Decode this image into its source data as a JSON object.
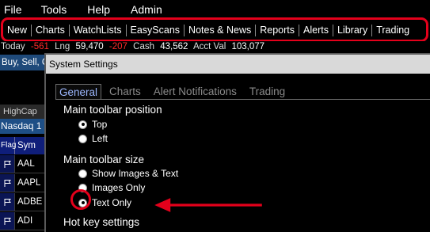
{
  "menubar": {
    "items": [
      "File",
      "Tools",
      "Help",
      "Admin"
    ]
  },
  "toolbar": {
    "items": [
      "New",
      "Charts",
      "WatchLists",
      "EasyScans",
      "Notes & News",
      "Reports",
      "Alerts",
      "Library",
      "Trading"
    ]
  },
  "account_strip": {
    "today_label": "Today",
    "today_value": "-561",
    "lng_label": "Lng",
    "lng_value": "59,470",
    "lng_change": "-207",
    "cash_label": "Cash",
    "cash_value": "43,562",
    "acct_label": "Acct Val",
    "acct_value": "103,077"
  },
  "left_panel": {
    "order_bar": "Buy, Sell, C",
    "tab_label": "HighCap",
    "list_title": "Nasdaq 1",
    "columns": [
      "Flag",
      "Sym"
    ],
    "rows": [
      "AAL",
      "AAPL",
      "ADBE",
      "ADI"
    ]
  },
  "dialog": {
    "title": "System Settings",
    "tabs": [
      "General",
      "Charts",
      "Alert Notifications",
      "Trading"
    ],
    "active_tab": "General",
    "position_section": "Main toolbar position",
    "position_options": [
      "Top",
      "Left"
    ],
    "position_selected": "Top",
    "size_section": "Main toolbar size",
    "size_options": [
      "Show Images & Text",
      "Images Only",
      "Text Only"
    ],
    "size_selected": "Text Only",
    "hotkey_section": "Hot key settings"
  },
  "colors": {
    "annotation": "#e4001b",
    "negative": "#ff2a2a",
    "active_tab": "#9db8ff",
    "header_blue": "#0f1e7a"
  }
}
